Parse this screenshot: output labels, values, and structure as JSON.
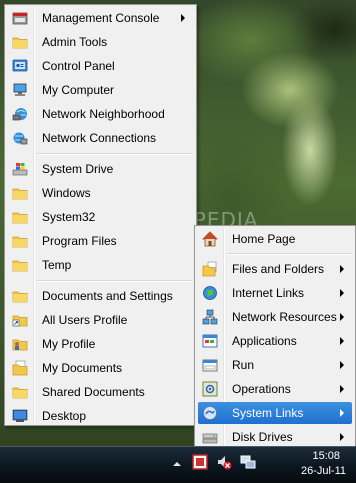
{
  "watermark": "SOFTPEDIA",
  "left_menu": {
    "groups": [
      [
        {
          "label": "Management Console",
          "icon": "management-console-icon",
          "submenu": true
        },
        {
          "label": "Admin Tools",
          "icon": "folder-icon",
          "submenu": false
        },
        {
          "label": "Control Panel",
          "icon": "control-panel-icon",
          "submenu": false
        },
        {
          "label": "My Computer",
          "icon": "computer-icon",
          "submenu": false
        },
        {
          "label": "Network Neighborhood",
          "icon": "network-neighborhood-icon",
          "submenu": false
        },
        {
          "label": "Network Connections",
          "icon": "network-connections-icon",
          "submenu": false
        }
      ],
      [
        {
          "label": "System Drive",
          "icon": "windows-drive-icon",
          "submenu": false
        },
        {
          "label": "Windows",
          "icon": "folder-icon",
          "submenu": false
        },
        {
          "label": "System32",
          "icon": "folder-icon",
          "submenu": false
        },
        {
          "label": "Program Files",
          "icon": "folder-icon",
          "submenu": false
        },
        {
          "label": "Temp",
          "icon": "folder-icon",
          "submenu": false
        }
      ],
      [
        {
          "label": "Documents and Settings",
          "icon": "folder-icon",
          "submenu": false
        },
        {
          "label": "All Users Profile",
          "icon": "shortcut-folder-icon",
          "submenu": false
        },
        {
          "label": "My Profile",
          "icon": "profile-folder-icon",
          "submenu": false
        },
        {
          "label": "My Documents",
          "icon": "documents-folder-icon",
          "submenu": false
        },
        {
          "label": "Shared Documents",
          "icon": "folder-icon",
          "submenu": false
        },
        {
          "label": "Desktop",
          "icon": "desktop-icon",
          "submenu": false
        }
      ]
    ]
  },
  "right_menu": {
    "items": [
      {
        "label": "Home Page",
        "icon": "home-icon",
        "submenu": false,
        "separator_after": true
      },
      {
        "label": "Files and Folders",
        "icon": "files-folders-icon",
        "submenu": true
      },
      {
        "label": "Internet Links",
        "icon": "internet-globe-icon",
        "submenu": true
      },
      {
        "label": "Network Resources",
        "icon": "network-resources-icon",
        "submenu": true
      },
      {
        "label": "Applications",
        "icon": "applications-window-icon",
        "submenu": true
      },
      {
        "label": "Run",
        "icon": "run-icon",
        "submenu": true
      },
      {
        "label": "Operations",
        "icon": "operations-icon",
        "submenu": true
      },
      {
        "label": "System Links",
        "icon": "system-links-icon",
        "submenu": true,
        "highlighted": true
      },
      {
        "label": "Disk Drives",
        "icon": "disk-drives-icon",
        "submenu": true
      }
    ]
  },
  "taskbar": {
    "time": "15:08",
    "date": "26-Jul-11",
    "tray_icons": [
      "show-hidden-icons-arrow-icon",
      "app-tray-icon",
      "volume-muted-icon",
      "network-tray-icon"
    ]
  },
  "colors": {
    "menu_bg": "#f0f0f0",
    "highlight": "#2a7bd8",
    "taskbar": "#0c1620"
  }
}
